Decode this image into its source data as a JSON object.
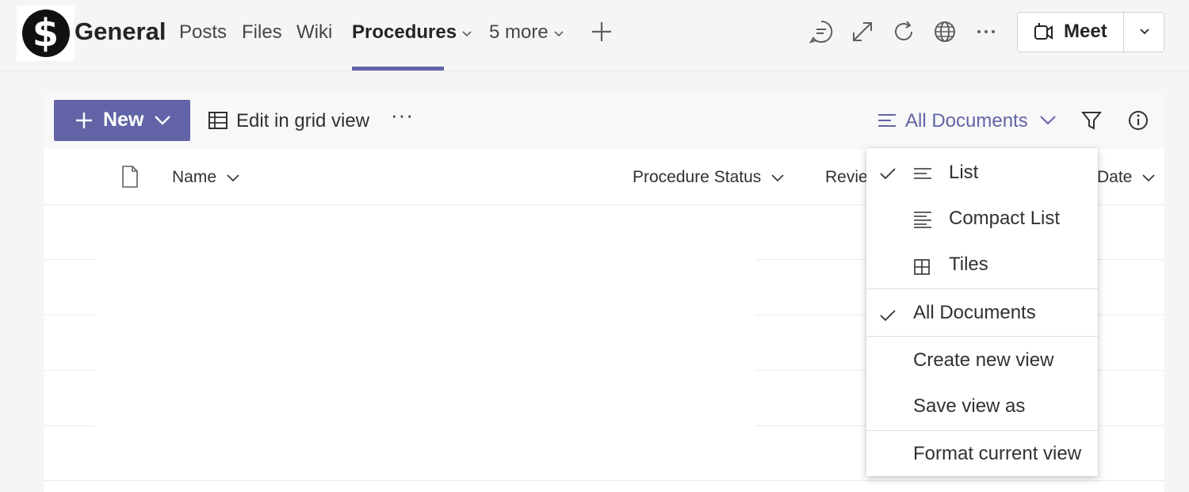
{
  "header": {
    "logo_glyph": "$",
    "channel_title": "General",
    "tabs": [
      {
        "label": "Posts"
      },
      {
        "label": "Files"
      },
      {
        "label": "Wiki"
      },
      {
        "label": "Procedures",
        "active": true
      },
      {
        "label": "5 more"
      }
    ],
    "icons": [
      "add-tab-icon",
      "chat-icon",
      "expand-icon",
      "refresh-icon",
      "globe-icon",
      "more-icon"
    ],
    "meet_label": "Meet"
  },
  "toolbar": {
    "new_label": "New",
    "grid_label": "Edit in grid view",
    "more_label": "···",
    "view_label": "All Documents"
  },
  "columns": {
    "name": "Name",
    "status": "Procedure Status",
    "review": "Review",
    "date": "Date"
  },
  "view_menu": {
    "layouts": [
      {
        "label": "List",
        "checked": true,
        "icon": "list-icon"
      },
      {
        "label": "Compact List",
        "checked": false,
        "icon": "compact-list-icon"
      },
      {
        "label": "Tiles",
        "checked": false,
        "icon": "tiles-icon"
      }
    ],
    "views": [
      {
        "label": "All Documents",
        "checked": true
      }
    ],
    "actions": [
      {
        "label": "Create new view"
      },
      {
        "label": "Save view as"
      },
      {
        "label": "Format current view"
      }
    ]
  },
  "colors": {
    "accent": "#6264a7",
    "text": "#252423",
    "background": "#f5f5f5"
  }
}
